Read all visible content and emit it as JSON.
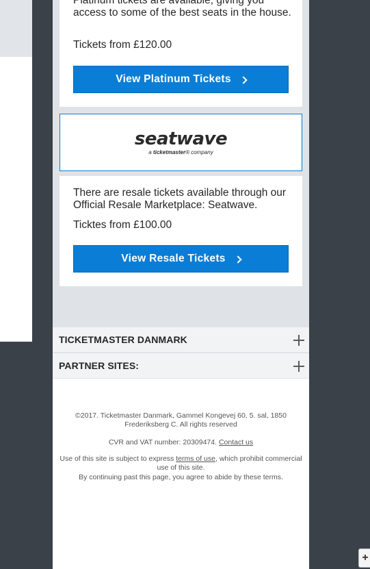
{
  "platinum": {
    "description": "Platinum tickets are available, giving you access to some of the best seats in the house.",
    "price": "Tickets from £120.00",
    "button_label": "View Platinum Tickets"
  },
  "resale": {
    "logo_word": "seatwave",
    "logo_sub_prefix": "a ",
    "logo_sub_brand": "ticketmaster",
    "logo_sub_suffix": "® company",
    "description": "There are resale tickets available through our Official Resale Marketplace: Seatwave.",
    "price": "Ticktes from £100.00",
    "button_label": "View Resale Tickets"
  },
  "accordion": {
    "items": [
      {
        "label": "TICKETMASTER DANMARK"
      },
      {
        "label": "PARTNER SITES:"
      }
    ]
  },
  "footer": {
    "copyright": "©2017. Ticketmaster Danmark, Gammel Kongevej 60, 5. sal, 1850 Frederiksberg C. All rights reserved",
    "cvr_text": "CVR and VAT number: 20309474. ",
    "contact_link": "Contact us",
    "terms_prefix": "Use of this site is subject to express ",
    "terms_link": "terms of use",
    "terms_suffix": ", which prohibit commercial use of this site.",
    "continue_text": "By continuing past this page, you agree to abide by these terms."
  },
  "corner_button": {
    "label": "+"
  },
  "colors": {
    "accent": "#0a7ed6",
    "page_bg": "#3b4149",
    "column_bg": "#dfe2e6"
  }
}
